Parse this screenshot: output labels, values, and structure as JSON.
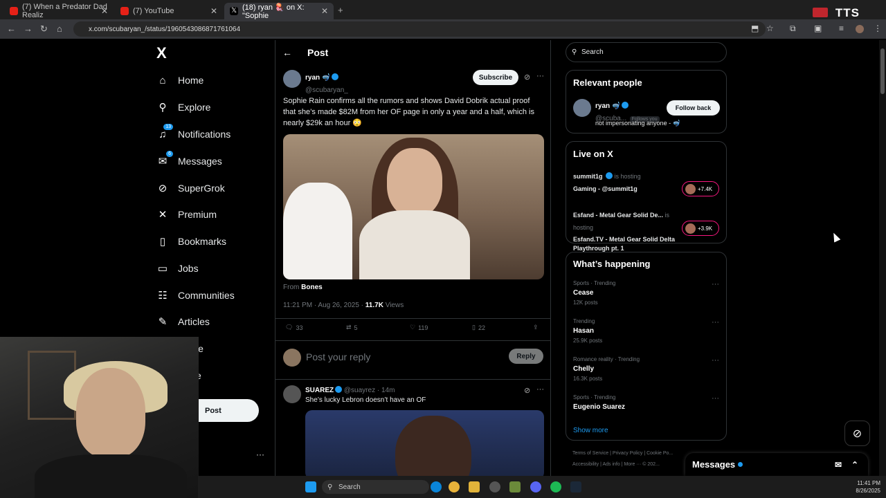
{
  "browser": {
    "tabs": [
      {
        "title": "(7) When a Predator Dad Realiz",
        "favicon": "youtube"
      },
      {
        "title": "(7) YouTube",
        "favicon": "youtube"
      },
      {
        "title": "(18) ryan 🪼 on X: \"Sophie",
        "favicon": "x"
      }
    ],
    "url": "x.com/scubaryan_/status/1960543086871761064",
    "tts_label": "TTS"
  },
  "sidebar": {
    "logo": "X",
    "items": [
      {
        "label": "Home",
        "icon": "home-icon"
      },
      {
        "label": "Explore",
        "icon": "search-icon"
      },
      {
        "label": "Notifications",
        "icon": "bell-icon",
        "badge": "13"
      },
      {
        "label": "Messages",
        "icon": "mail-icon",
        "badge": "6"
      },
      {
        "label": "SuperGrok",
        "icon": "grok-icon"
      },
      {
        "label": "Premium",
        "icon": "x-icon"
      },
      {
        "label": "Bookmarks",
        "icon": "bookmark-icon"
      },
      {
        "label": "Jobs",
        "icon": "briefcase-icon"
      },
      {
        "label": "Communities",
        "icon": "people-icon"
      },
      {
        "label": "Articles",
        "icon": "article-icon"
      },
      {
        "label": "le",
        "icon": "profile-icon"
      },
      {
        "label": "e",
        "icon": "more-icon"
      }
    ],
    "post_button": "Post",
    "more_dots": "···"
  },
  "post": {
    "header_title": "Post",
    "author_name": "ryan 🤿",
    "author_handle": "@scubaryan_",
    "subscribe_label": "Subscribe",
    "text": "Sophie Rain confirms all the rumors and shows David Dobrik actual proof that she’s made $82M from her OF page in only a year and a half, which is nearly $29k an hour 😳",
    "from_label": "From",
    "from_source": "Bones",
    "timestamp": "11:21 PM · Aug 26, 2025 ·",
    "views_count": "11.7K",
    "views_label": "Views",
    "replies": "33",
    "reposts": "5",
    "likes": "119",
    "bookmarks": "22",
    "reply_placeholder": "Post your reply",
    "reply_button": "Reply"
  },
  "reply": {
    "author_name": "SUAREZ",
    "author_handle": "@suayrez · 14m",
    "text": "She’s lucky Lebron doesn’t have an OF"
  },
  "right": {
    "search_placeholder": "Search",
    "relevant_title": "Relevant people",
    "relevant_name": "ryan 🤿",
    "relevant_handle": "@scuba...",
    "follows_you": "Follows you",
    "relevant_bio": "not impersonating anyone - 🤿",
    "follow_back": "Follow back",
    "live_title": "Live on X",
    "live": [
      {
        "host": "summit1g",
        "status": "is hosting",
        "title": "Gaming - @summit1g",
        "count": "+7.4K"
      },
      {
        "host": "Esfand - Metal Gear Solid De...",
        "status": "is hosting",
        "title": "Esfand.TV - Metal Gear Solid Delta Playthrough pt. 1",
        "count": "+3.9K"
      }
    ],
    "happening_title": "What’s happening",
    "trends": [
      {
        "context": "Sports · Trending",
        "name": "Cease",
        "posts": "12K posts"
      },
      {
        "context": "Trending",
        "name": "Hasan",
        "posts": "25.9K posts"
      },
      {
        "context": "Romance reality · Trending",
        "name": "Chelly",
        "posts": "16.3K posts"
      },
      {
        "context": "Sports · Trending",
        "name": "Eugenio Suarez",
        "posts": ""
      }
    ],
    "show_more": "Show more",
    "footer1": "Terms of Service  |  Privacy Policy  |  Cookie Po...",
    "footer2": "Accessibility  |  Ads info  |  More ···  © 202..."
  },
  "messages_drawer": {
    "label": "Messages"
  },
  "taskbar": {
    "search": "Search",
    "time": "11:41 PM",
    "date": "8/26/2025"
  },
  "colors": {
    "accent": "#1d9bf0",
    "live": "#f91880",
    "background": "#000000"
  }
}
